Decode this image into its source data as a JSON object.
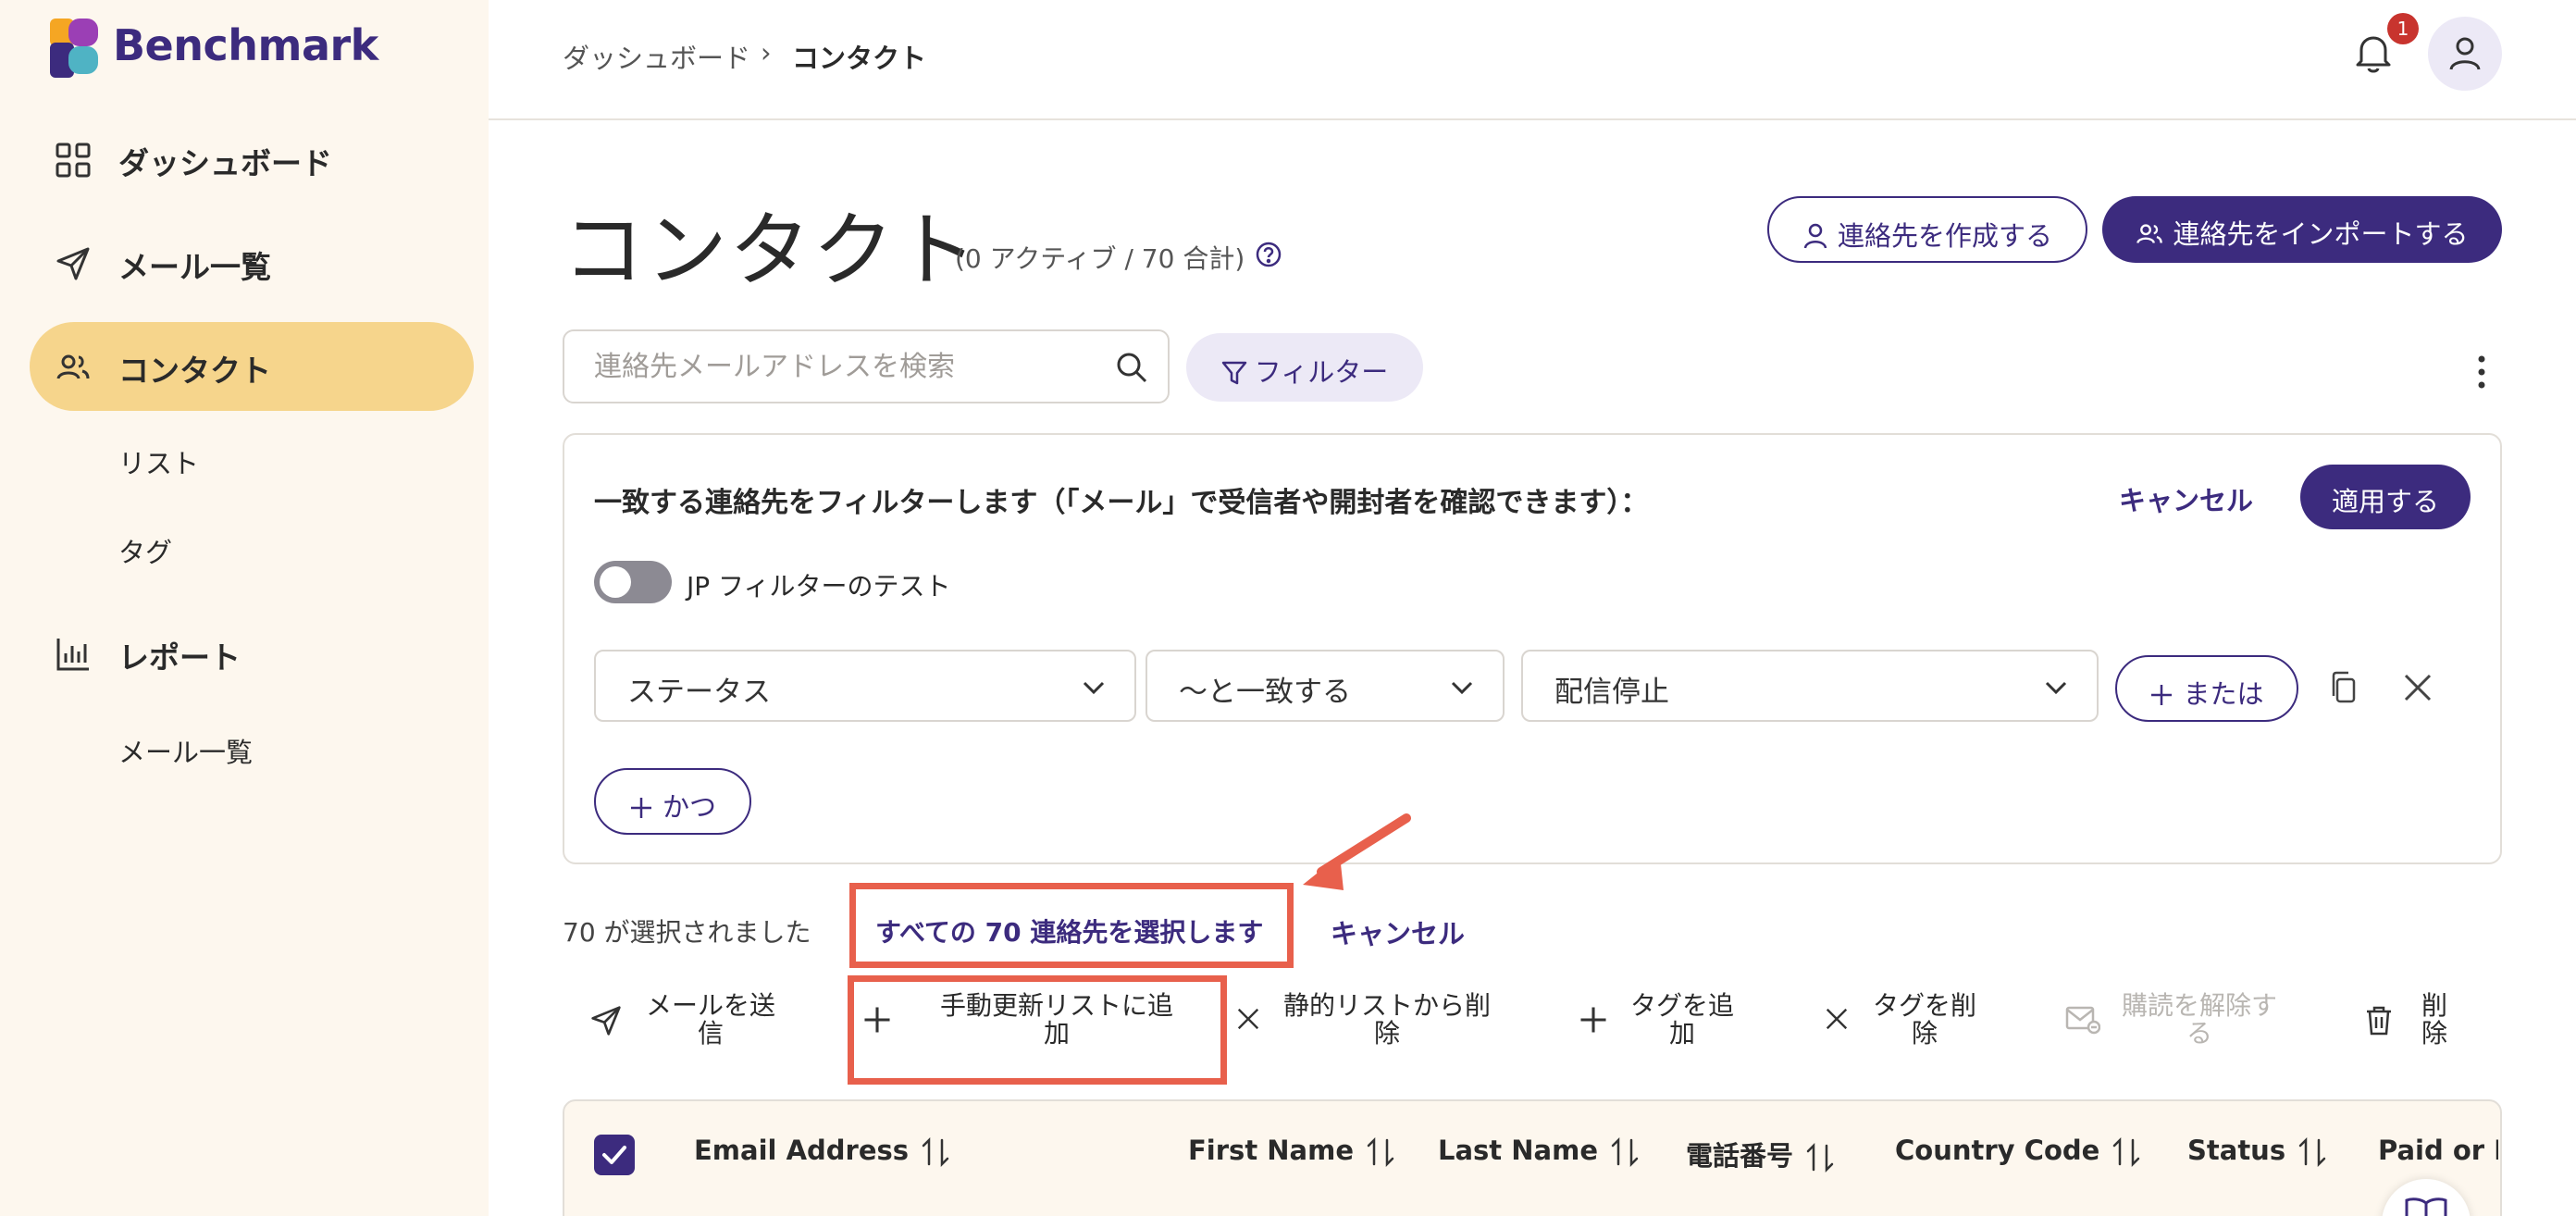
{
  "brand": {
    "name": "Benchmark",
    "colors": {
      "primary": "#3c2b7e",
      "highlight": "#e8604c",
      "nav_active": "#f6d58c",
      "sidebar_bg": "#fdf7ee"
    }
  },
  "sidebar": {
    "items": [
      {
        "label": "ダッシュボード",
        "icon": "grid-icon"
      },
      {
        "label": "メール一覧",
        "icon": "send-icon"
      },
      {
        "label": "コンタクト",
        "icon": "users-icon",
        "active": true
      },
      {
        "label": "リスト"
      },
      {
        "label": "タグ"
      },
      {
        "label": "レポート",
        "icon": "bar-chart-icon"
      },
      {
        "label": "メール一覧"
      }
    ]
  },
  "header": {
    "breadcrumb": [
      "ダッシュボード",
      "コンタクト"
    ],
    "breadcrumb_separator": "›",
    "notification_count": "1"
  },
  "main": {
    "title": "コンタクト",
    "subtitle": "(0 アクティブ / 70 合計)",
    "create_button": "連絡先を作成する",
    "import_button": "連絡先をインポートする",
    "search_placeholder": "連絡先メールアドレスを検索",
    "filter_button": "フィルター"
  },
  "filter_panel": {
    "description": "一致する連絡先をフィルターします（「メール」で受信者や開封者を確認できます）：",
    "cancel": "キャンセル",
    "apply": "適用する",
    "toggle_label": "JP フィルターのテスト",
    "toggle_on": false,
    "field_value": "ステータス",
    "operator_value": "〜と一致する",
    "condition_value": "配信停止",
    "or_button": "または",
    "and_button": "かつ"
  },
  "selection": {
    "count_text": "70 が選択されました",
    "select_all": "すべての 70 連絡先を選択します",
    "cancel": "キャンセル"
  },
  "actions": [
    {
      "line1": "メールを送",
      "line2": "信",
      "icon": "send-icon"
    },
    {
      "line1": "手動更新リストに追",
      "line2": "加",
      "icon": "plus-icon"
    },
    {
      "line1": "静的リストから削",
      "line2": "除",
      "icon": "x-icon"
    },
    {
      "line1": "タグを追",
      "line2": "加",
      "icon": "plus-icon"
    },
    {
      "line1": "タグを削",
      "line2": "除",
      "icon": "x-icon"
    },
    {
      "line1": "購読を解除す",
      "line2": "る",
      "icon": "mail-unsubscribe-icon",
      "disabled": true
    },
    {
      "line1": "削",
      "line2": "除",
      "icon": "trash-icon"
    }
  ],
  "table": {
    "columns": [
      "Email Address",
      "First Name",
      "Last Name",
      "電話番号",
      "Country Code",
      "Status",
      "Paid or Fr"
    ],
    "all_selected": true
  }
}
